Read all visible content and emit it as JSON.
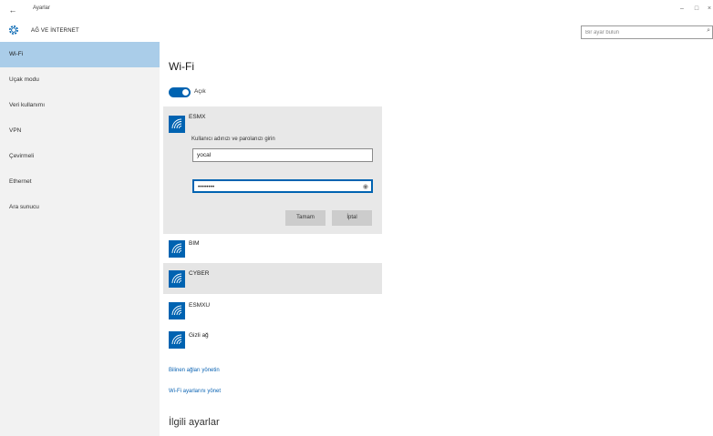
{
  "window": {
    "title": "Ayarlar",
    "back_glyph": "←",
    "minimize_glyph": "–",
    "maximize_glyph": "□",
    "close_glyph": "×"
  },
  "header": {
    "section_title": "AĞ VE İNTERNET",
    "search_placeholder": "Bir ayar bulun",
    "search_icon": "search-icon"
  },
  "sidebar": {
    "items": [
      {
        "label": "Wi-Fi",
        "active": true
      },
      {
        "label": "Uçak modu",
        "active": false
      },
      {
        "label": "Veri kullanımı",
        "active": false
      },
      {
        "label": "VPN",
        "active": false
      },
      {
        "label": "Çevirmeli",
        "active": false
      },
      {
        "label": "Ethernet",
        "active": false
      },
      {
        "label": "Ara sunucu",
        "active": false
      }
    ]
  },
  "main": {
    "title": "Wi-Fi",
    "toggle": {
      "state": "Açık",
      "on": true
    },
    "expanded_network": {
      "name": "ESMX",
      "prompt": "Kullanıcı adınızı ve parolanızı girin",
      "username_value": "yocal",
      "password_value": "••••••••",
      "cancel_label": "Tamam",
      "ok_label": "İptal"
    },
    "networks": [
      {
        "name": "BIM"
      },
      {
        "name": "CYBER"
      },
      {
        "name": "ESMXU"
      },
      {
        "name": "Gizli ağ"
      }
    ],
    "links": [
      "Bilinen ağları yönetin",
      "Wi-Fi ayarlarını yönet"
    ],
    "related_heading": "İlgili ayarlar"
  },
  "colors": {
    "accent": "#0063b1",
    "sidebar_bg": "#f2f2f2",
    "sidebar_active": "#aacde9",
    "link": "#0a63b3"
  }
}
